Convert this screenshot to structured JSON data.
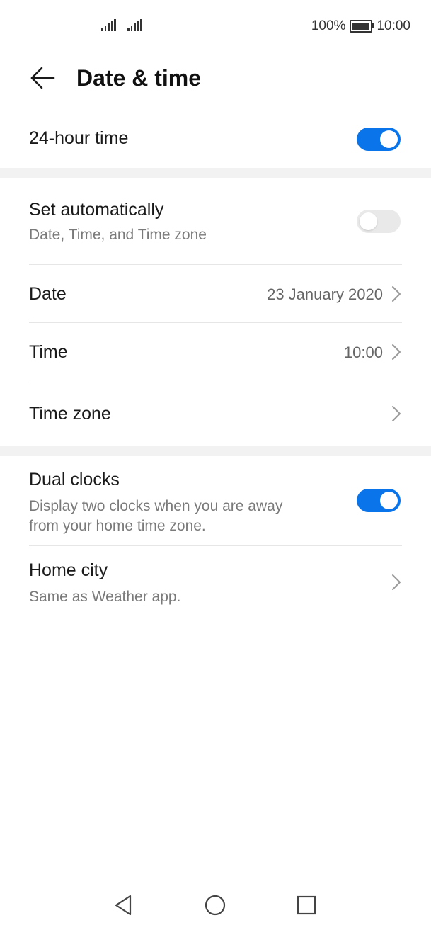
{
  "status_bar": {
    "battery_percent": "100%",
    "time": "10:00",
    "battery_level": 1.0,
    "icons": [
      "signal-icon",
      "signal-icon",
      "battery-icon"
    ]
  },
  "header": {
    "title": "Date & time",
    "back_icon": "arrow-left-icon"
  },
  "settings": {
    "hour24": {
      "label": "24-hour time",
      "enabled": true
    },
    "set_automatically": {
      "label": "Set automatically",
      "sub": "Date, Time, and Time zone",
      "enabled": false
    },
    "date": {
      "label": "Date",
      "value": "23 January 2020"
    },
    "time": {
      "label": "Time",
      "value": "10:00"
    },
    "time_zone": {
      "label": "Time zone"
    },
    "dual_clocks": {
      "label": "Dual clocks",
      "sub_line1": "Display two clocks when you are away",
      "sub_line2": "from your home time zone.",
      "enabled": true
    },
    "home_city": {
      "label": "Home city",
      "sub": "Same as Weather app."
    }
  },
  "colors": {
    "accent": "#0a74ea",
    "toggle_off": "#e9e9e9",
    "section_band": "#f2f2f2"
  },
  "navbar": {
    "icons": [
      "back-triangle-icon",
      "home-circle-icon",
      "recents-square-icon"
    ]
  }
}
